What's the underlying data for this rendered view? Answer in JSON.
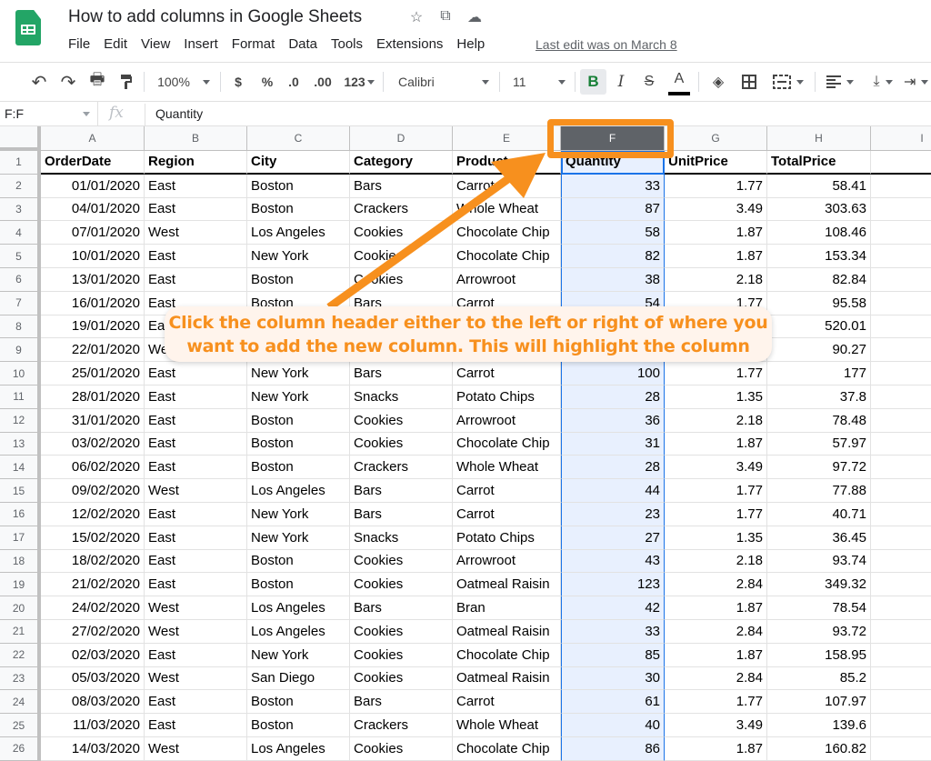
{
  "app": {
    "doc_title": "How to add columns in Google Sheets",
    "title_icons": [
      "star-icon",
      "move-to-folder-icon",
      "cloud-saved-icon"
    ],
    "menu": [
      "File",
      "Edit",
      "View",
      "Insert",
      "Format",
      "Data",
      "Tools",
      "Extensions",
      "Help"
    ],
    "last_edit": "Last edit was on March 8"
  },
  "toolbar": {
    "zoom": "100%",
    "currency": "$",
    "percent": "%",
    "decrease_decimal": ".0",
    "increase_decimal": ".00",
    "more_formats": "123",
    "font": "Calibri",
    "font_size": "11",
    "bold": "B",
    "italic": "I",
    "strikethrough": "S",
    "text_color": "A",
    "icons": [
      "undo-icon",
      "redo-icon",
      "print-icon",
      "paint-format-icon",
      "fill-color-icon",
      "borders-icon",
      "merge-cells-icon",
      "horizontal-align-icon",
      "vertical-align-icon",
      "text-wrap-icon"
    ]
  },
  "formula_bar": {
    "name_box": "F:F",
    "fx": "fx",
    "value": "Quantity"
  },
  "grid": {
    "selected_column": "F",
    "columns": [
      "A",
      "B",
      "C",
      "D",
      "E",
      "F",
      "G",
      "H",
      "I"
    ],
    "header": [
      "OrderDate",
      "Region",
      "City",
      "Category",
      "Product",
      "Quantity",
      "UnitPrice",
      "TotalPrice"
    ],
    "rows": [
      {
        "n": "2",
        "c": [
          "01/01/2020",
          "East",
          "Boston",
          "Bars",
          "Carrot",
          "33",
          "1.77",
          "58.41"
        ]
      },
      {
        "n": "3",
        "c": [
          "04/01/2020",
          "East",
          "Boston",
          "Crackers",
          "Whole Wheat",
          "87",
          "3.49",
          "303.63"
        ]
      },
      {
        "n": "4",
        "c": [
          "07/01/2020",
          "West",
          "Los Angeles",
          "Cookies",
          "Chocolate Chip",
          "58",
          "1.87",
          "108.46"
        ]
      },
      {
        "n": "5",
        "c": [
          "10/01/2020",
          "East",
          "New York",
          "Cookies",
          "Chocolate Chip",
          "82",
          "1.87",
          "153.34"
        ]
      },
      {
        "n": "6",
        "c": [
          "13/01/2020",
          "East",
          "Boston",
          "Cookies",
          "Arrowroot",
          "38",
          "2.18",
          "82.84"
        ]
      },
      {
        "n": "7",
        "c": [
          "16/01/2020",
          "East",
          "Boston",
          "Bars",
          "Carrot",
          "54",
          "1.77",
          "95.58"
        ]
      },
      {
        "n": "8",
        "c": [
          "19/01/2020",
          "East",
          "",
          "",
          "",
          "",
          "",
          "520.01"
        ]
      },
      {
        "n": "9",
        "c": [
          "22/01/2020",
          "West",
          "",
          "",
          "",
          "",
          "",
          "90.27"
        ]
      },
      {
        "n": "10",
        "c": [
          "25/01/2020",
          "East",
          "New York",
          "Bars",
          "Carrot",
          "100",
          "1.77",
          "177"
        ]
      },
      {
        "n": "11",
        "c": [
          "28/01/2020",
          "East",
          "New York",
          "Snacks",
          "Potato Chips",
          "28",
          "1.35",
          "37.8"
        ]
      },
      {
        "n": "12",
        "c": [
          "31/01/2020",
          "East",
          "Boston",
          "Cookies",
          "Arrowroot",
          "36",
          "2.18",
          "78.48"
        ]
      },
      {
        "n": "13",
        "c": [
          "03/02/2020",
          "East",
          "Boston",
          "Cookies",
          "Chocolate Chip",
          "31",
          "1.87",
          "57.97"
        ]
      },
      {
        "n": "14",
        "c": [
          "06/02/2020",
          "East",
          "Boston",
          "Crackers",
          "Whole Wheat",
          "28",
          "3.49",
          "97.72"
        ]
      },
      {
        "n": "15",
        "c": [
          "09/02/2020",
          "West",
          "Los Angeles",
          "Bars",
          "Carrot",
          "44",
          "1.77",
          "77.88"
        ]
      },
      {
        "n": "16",
        "c": [
          "12/02/2020",
          "East",
          "New York",
          "Bars",
          "Carrot",
          "23",
          "1.77",
          "40.71"
        ]
      },
      {
        "n": "17",
        "c": [
          "15/02/2020",
          "East",
          "New York",
          "Snacks",
          "Potato Chips",
          "27",
          "1.35",
          "36.45"
        ]
      },
      {
        "n": "18",
        "c": [
          "18/02/2020",
          "East",
          "Boston",
          "Cookies",
          "Arrowroot",
          "43",
          "2.18",
          "93.74"
        ]
      },
      {
        "n": "19",
        "c": [
          "21/02/2020",
          "East",
          "Boston",
          "Cookies",
          "Oatmeal Raisin",
          "123",
          "2.84",
          "349.32"
        ]
      },
      {
        "n": "20",
        "c": [
          "24/02/2020",
          "West",
          "Los Angeles",
          "Bars",
          "Bran",
          "42",
          "1.87",
          "78.54"
        ]
      },
      {
        "n": "21",
        "c": [
          "27/02/2020",
          "West",
          "Los Angeles",
          "Cookies",
          "Oatmeal Raisin",
          "33",
          "2.84",
          "93.72"
        ]
      },
      {
        "n": "22",
        "c": [
          "02/03/2020",
          "East",
          "New York",
          "Cookies",
          "Chocolate Chip",
          "85",
          "1.87",
          "158.95"
        ]
      },
      {
        "n": "23",
        "c": [
          "05/03/2020",
          "West",
          "San Diego",
          "Cookies",
          "Oatmeal Raisin",
          "30",
          "2.84",
          "85.2"
        ]
      },
      {
        "n": "24",
        "c": [
          "08/03/2020",
          "East",
          "Boston",
          "Bars",
          "Carrot",
          "61",
          "1.77",
          "107.97"
        ]
      },
      {
        "n": "25",
        "c": [
          "11/03/2020",
          "East",
          "Boston",
          "Crackers",
          "Whole Wheat",
          "40",
          "3.49",
          "139.6"
        ]
      },
      {
        "n": "26",
        "c": [
          "14/03/2020",
          "West",
          "Los Angeles",
          "Cookies",
          "Chocolate Chip",
          "86",
          "1.87",
          "160.82"
        ]
      }
    ]
  },
  "annotation": {
    "callout_line1": "Click the column header either to the left or right of where you",
    "callout_line2": "want to add the new column. This will highlight the column",
    "accent_color": "#f7901e"
  }
}
